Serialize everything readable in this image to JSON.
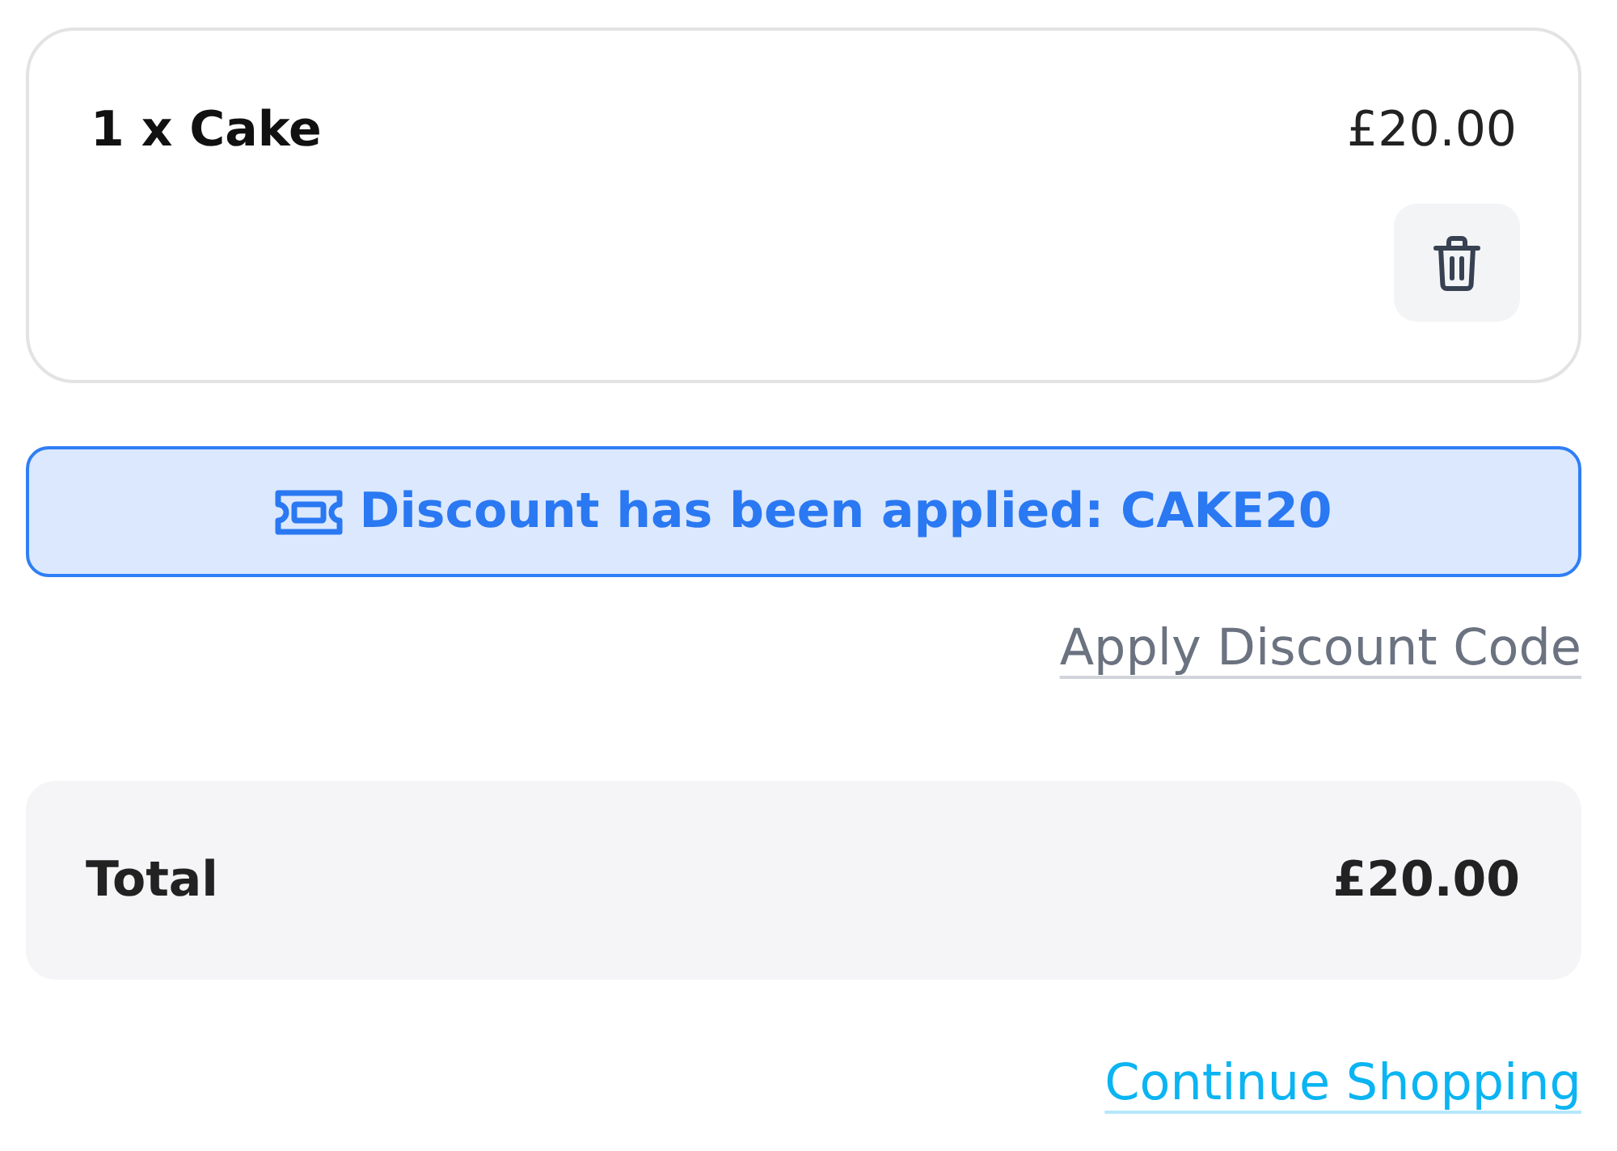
{
  "cart_items": [
    {
      "name": "1 x Cake",
      "price": "£20.00"
    }
  ],
  "discount_notice": {
    "text": "Discount has been applied: CAKE20"
  },
  "apply_discount_link": "Apply Discount Code",
  "total": {
    "label": "Total",
    "amount": "£20.00"
  },
  "continue_link": "Continue Shopping"
}
